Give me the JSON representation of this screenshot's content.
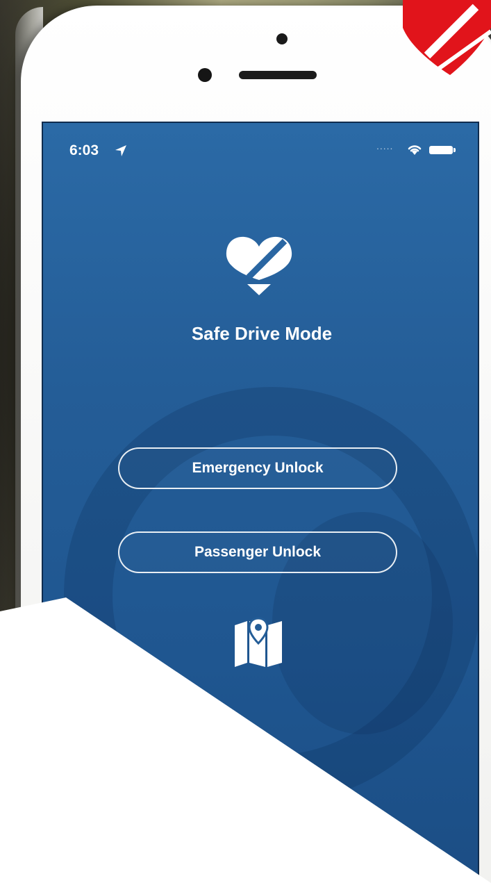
{
  "status_bar": {
    "time": "6:03",
    "signal_dots": ".....",
    "icons": [
      "location-arrow-icon",
      "wifi-icon",
      "battery-icon"
    ]
  },
  "app": {
    "title": "Safe Drive Mode",
    "logo_icon": "heart-logo-icon",
    "buttons": {
      "emergency_unlock": "Emergency Unlock",
      "passenger_unlock": "Passenger Unlock"
    },
    "map_icon": "map-pin-icon"
  },
  "colors": {
    "screen_blue": "#245d97",
    "button_border": "#ffffff",
    "brand_red": "#e1141b"
  }
}
